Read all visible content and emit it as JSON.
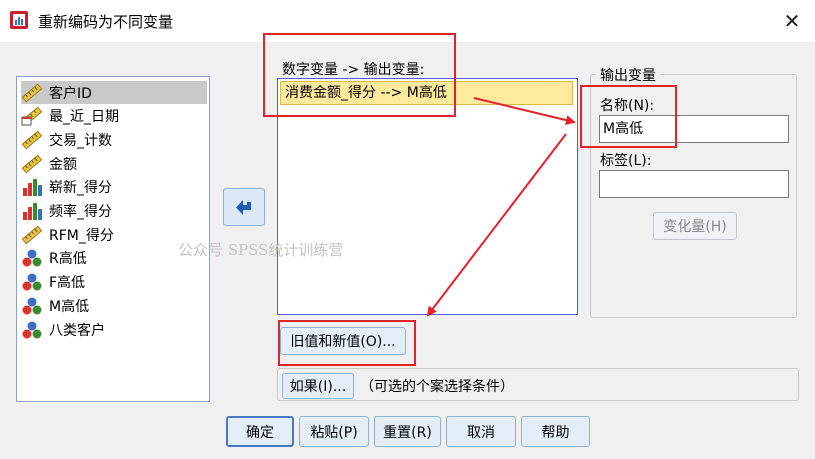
{
  "window": {
    "title": "重新编码为不同变量"
  },
  "variables": [
    {
      "label": "客户ID",
      "icon": "ruler-icon",
      "selected": true
    },
    {
      "label": "最_近_日期",
      "icon": "calendar-ruler-icon",
      "selected": false
    },
    {
      "label": "交易_计数",
      "icon": "ruler-icon",
      "selected": false
    },
    {
      "label": "金额",
      "icon": "ruler-icon",
      "selected": false
    },
    {
      "label": "崭新_得分",
      "icon": "bar-chart-icon",
      "selected": false
    },
    {
      "label": "频率_得分",
      "icon": "bar-chart-icon",
      "selected": false
    },
    {
      "label": "RFM_得分",
      "icon": "ruler-icon",
      "selected": false
    },
    {
      "label": "R高低",
      "icon": "nominal-icon",
      "selected": false
    },
    {
      "label": "F高低",
      "icon": "nominal-icon",
      "selected": false
    },
    {
      "label": "M高低",
      "icon": "nominal-icon",
      "selected": false
    },
    {
      "label": "八类客户",
      "icon": "nominal-icon",
      "selected": false
    }
  ],
  "mapping": {
    "label": "数字变量 -> 输出变量:",
    "items": [
      "消费金额_得分 --> M高低"
    ]
  },
  "output": {
    "legend": "输出变量",
    "name_label": "名称(N):",
    "name_value": "M高低",
    "label_label": "标签(L):",
    "label_value": "",
    "change_button": "变化量(H)"
  },
  "buttons": {
    "old_new": "旧值和新值(O)...",
    "if": "如果(I)...",
    "if_caption": "（可选的个案选择条件）",
    "ok": "确定",
    "paste": "粘贴(P)",
    "reset": "重置(R)",
    "cancel": "取消",
    "help": "帮助"
  },
  "watermark": "公众号 SPSS统计训练营",
  "colors": {
    "annotation_red": "#e0242a",
    "selection_yellow": "#ffe99a",
    "button_blue": "#e3eef9"
  }
}
